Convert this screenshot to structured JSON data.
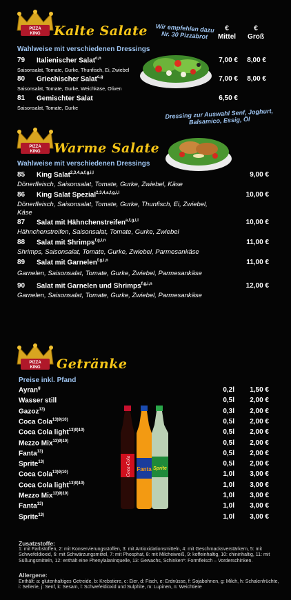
{
  "kalte": {
    "title": "Kalte Salate",
    "subtitle": "Wahlweise mit verschiedenen Dressings",
    "note": "Wir empfehlen dazu Nr. 30 Pizzabrot",
    "col_mittel": "€\nMittel",
    "col_gross": "€\nGroß",
    "items": [
      {
        "num": "79",
        "name": "Italienischer Salat",
        "sup": "c,n",
        "desc": "Saisonsalat, Tomate, Gurke, Thunfisch, Ei, Zwiebel",
        "p1": "7,00 €",
        "p2": "8,00 €"
      },
      {
        "num": "80",
        "name": "Griechischer Salat",
        "sup": "c,g",
        "desc": "Saisonsalat, Tomate, Gurke, Weichkäse, Oliven",
        "p1": "7,00 €",
        "p2": "8,00 €"
      },
      {
        "num": "81",
        "name": "Gemischter Salat",
        "sup": "",
        "desc": "Saisonsalat, Tomate, Gurke",
        "p1": "6,50 €",
        "p2": ""
      }
    ]
  },
  "warme": {
    "title": "Warme Salate",
    "subtitle": "Wahlweise mit verschiedenen Dressings",
    "note": "Dressing zur Auswahl Senf, Joghurt, Balsamico, Essig, Öl",
    "items": [
      {
        "num": "85",
        "name": "King Salat",
        "sup": "2,3,4,a,f,g,i,l",
        "desc": "Dönerfleisch, Saisonsalat, Tomate, Gurke, Zwiebel, Käse",
        "price": "9,00 €"
      },
      {
        "num": "86",
        "name": "King Salat Spezial",
        "sup": "2,3,4,a,f,g,i,l",
        "desc": "Dönerfleisch, Saisonsalat, Tomate, Gurke, Thunfisch, Ei, Zwiebel, Käse",
        "price": "10,00 €"
      },
      {
        "num": "87",
        "name": "Salat mit Hähnchenstreifen",
        "sup": "a,f,g,i,l",
        "desc": "Hähnchenstreifen, Saisonsalat, Tomate, Gurke, Zwiebel",
        "price": "10,00 €"
      },
      {
        "num": "88",
        "name": "Salat mit Shrimps",
        "sup": "f,g,i,n",
        "desc": "Shrimps, Saisonsalat, Tomate, Gurke, Zwiebel, Parmesankäse",
        "price": "11,00 €"
      },
      {
        "num": "89",
        "name": "Salat mit Garnelen",
        "sup": "f,g,i,n",
        "desc": "Garnelen, Saisonsalat, Tomate, Gurke, Zwiebel, Parmesankäse",
        "price": "11,00 €"
      },
      {
        "num": "90",
        "name": "Salat mit Garnelen und Shrimps",
        "sup": "f,g,i,n",
        "desc": "Garnelen, Saisonsalat, Tomate, Gurke, Zwiebel, Parmesankäse",
        "price": "12,00 €"
      }
    ]
  },
  "getraenke": {
    "title": "Getränke",
    "subtitle": "Preise inkl. Pfand",
    "items": [
      {
        "name": "Ayran",
        "sup": "g",
        "vol": "0,2l",
        "price": "1,50 €"
      },
      {
        "name": "Wasser still",
        "sup": "",
        "vol": "0,5l",
        "price": "2,00 €"
      },
      {
        "name": "Gazoz",
        "sup": "13)",
        "vol": "0,3l",
        "price": "2,00 €"
      },
      {
        "name": "Coca Cola",
        "sup": "13)9)10)",
        "vol": "0,5l",
        "price": "2,00 €"
      },
      {
        "name": "Coca Cola light",
        "sup": "13)9)10)",
        "vol": "0,5l",
        "price": "2,00 €"
      },
      {
        "name": "Mezzo Mix",
        "sup": "13)9)10)",
        "vol": "0,5l",
        "price": "2,00 €"
      },
      {
        "name": "Fanta",
        "sup": "13)",
        "vol": "0,5l",
        "price": "2,00 €"
      },
      {
        "name": "Sprite",
        "sup": "13)",
        "vol": "0,5l",
        "price": "2,00 €"
      },
      {
        "name": "Coca Cola",
        "sup": "13)9)10)",
        "vol": "1,0l",
        "price": "3,00 €"
      },
      {
        "name": "Coca Cola light",
        "sup": "13)9)10)",
        "vol": "1,0l",
        "price": "3,00 €"
      },
      {
        "name": "Mezzo Mix",
        "sup": "13)9)10)",
        "vol": "1,0l",
        "price": "3,00 €"
      },
      {
        "name": "Fanta",
        "sup": "13)",
        "vol": "1,0l",
        "price": "3,00 €"
      },
      {
        "name": "Sprite",
        "sup": "13)",
        "vol": "1,0l",
        "price": "3,00 €"
      }
    ]
  },
  "footer": {
    "zusatz_title": "Zusatzstoffe:",
    "zusatz_text": "1: mit Farbstoffen, 2: mit Konservierungsstoffen, 3: mit Antioxidationsmitteln, 4: mit Geschmacksverstärkern, 5: mit Schwefeldioxid, 6: mit Schwärzungsmittel, 7: mit Phosphat, 8: mit Milcheiweiß, 9: koffeinhaltig, 10: chininhaltig, 11: mit Süßungsmitteln, 12: enthält eine Phenylalaninquelle, 13: Gewachs, Schinken*: Formfleisch – Vorderschinken.",
    "allergene_title": "Allergene:",
    "allergene_text": "Enthält: a: glutenhaltiges Getreide, b: Krebstiere, c: Eier, d: Fisch, e: Erdnüsse, f: Sojabohnen, g: Milch, h: Schalenfrüchte, i: Sellerie, j: Senf, k: Sesam, l: Schwefeldioxid und Sulphite, m: Lupinen, n: Weichtiere"
  },
  "logo": {
    "line1": "PIZZA",
    "line2": "KING"
  },
  "bottles": {
    "cola": "Coca-Cola",
    "fanta": "Fanta",
    "sprite": "Sprite"
  }
}
